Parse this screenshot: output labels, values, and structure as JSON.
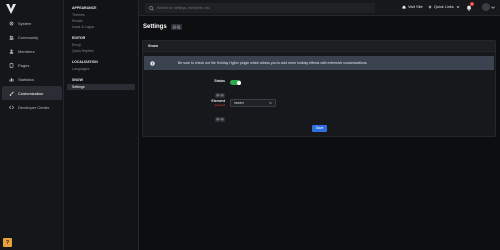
{
  "sidebar": {
    "items": [
      {
        "label": "System",
        "icon": "gear-icon"
      },
      {
        "label": "Community",
        "icon": "users-icon"
      },
      {
        "label": "Members",
        "icon": "user-icon"
      },
      {
        "label": "Pages",
        "icon": "file-icon"
      },
      {
        "label": "Statistics",
        "icon": "chart-icon"
      },
      {
        "label": "Customization",
        "icon": "brush-icon",
        "active": true
      },
      {
        "label": "Developer Center",
        "icon": "code-icon"
      }
    ],
    "help_label": "?"
  },
  "submenu": {
    "sections": [
      {
        "heading": "APPEARANCE",
        "items": [
          "Themes",
          "Emails",
          "Icons & Logos"
        ]
      },
      {
        "heading": "EDITOR",
        "items": [
          "Emoji",
          "Quick Replies"
        ]
      },
      {
        "heading": "LOCALIZATION",
        "items": [
          "Languages"
        ]
      },
      {
        "heading": "SNOW",
        "items": [
          "Settings"
        ]
      }
    ]
  },
  "topbar": {
    "search_placeholder": "Search for settings, members, etc.",
    "visit_site": "Visit Site",
    "quick_links": "Quick Links",
    "notification_count": "1"
  },
  "page": {
    "title": "Settings",
    "title_tag": "{{L:i}}"
  },
  "card": {
    "heading": "Snow",
    "alert_text": "Be sure to check out the Holiday Hyjinx plugin which allows you to add more holiday effects with extensive customizations.",
    "status_label": "Status",
    "status_tag": "{{L:i}}",
    "status_on": true,
    "element_label": "Element",
    "element_required": "required",
    "element_tag": "{{L:i}}",
    "element_value": "header",
    "save_label": "Save"
  },
  "colors": {
    "accent": "#2f6fe0",
    "toggle_on": "#2fa84f",
    "alert_bg": "#3b4350",
    "help": "#e9a23b"
  }
}
